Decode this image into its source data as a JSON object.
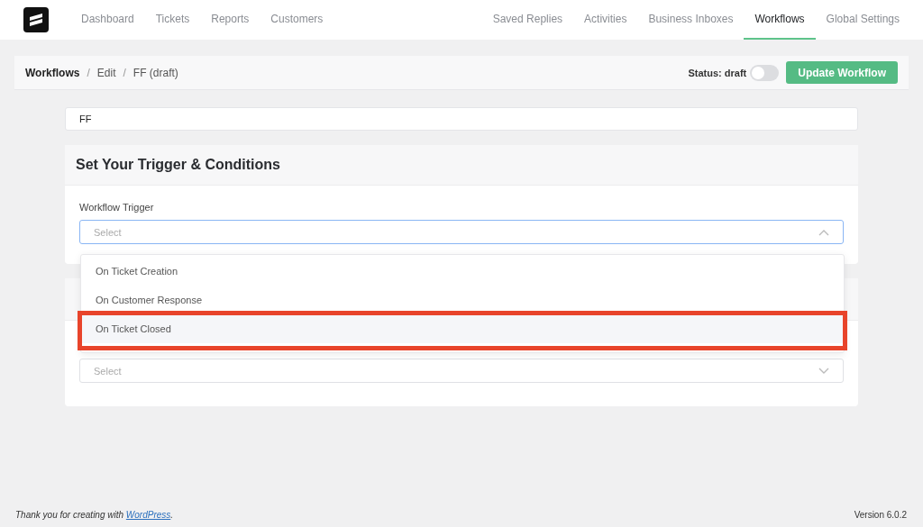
{
  "nav": {
    "left": [
      {
        "label": "Dashboard",
        "selected": false
      },
      {
        "label": "Tickets",
        "selected": false
      },
      {
        "label": "Reports",
        "selected": false
      },
      {
        "label": "Customers",
        "selected": false
      }
    ],
    "right": [
      {
        "label": "Saved Replies",
        "selected": false
      },
      {
        "label": "Activities",
        "selected": false
      },
      {
        "label": "Business Inboxes",
        "selected": false
      },
      {
        "label": "Workflows",
        "selected": true
      },
      {
        "label": "Global Settings",
        "selected": false
      }
    ]
  },
  "breadcrumb": [
    "Workflows",
    "Edit",
    "FF (draft)"
  ],
  "breadcrumb_separator": "/",
  "status": {
    "label": "Status: draft",
    "on": false
  },
  "update_button": "Update Workflow",
  "name_field": {
    "value": "FF"
  },
  "trigger_card": {
    "title": "Set Your Trigger & Conditions",
    "label": "Workflow Trigger",
    "select": {
      "placeholder": "Select",
      "expanded": true
    },
    "options": [
      {
        "label": "On Ticket Creation",
        "selected": false,
        "annotated": false
      },
      {
        "label": "On Customer Response",
        "selected": false,
        "annotated": false
      },
      {
        "label": "On Ticket Closed",
        "selected": true,
        "annotated": true
      }
    ]
  },
  "second_card": {
    "select": {
      "placeholder": "Select",
      "expanded": false
    }
  },
  "footer": {
    "text": "Thank you for creating with ",
    "link": "WordPress",
    "text_after": ".",
    "version": "Version 6.0.2"
  }
}
